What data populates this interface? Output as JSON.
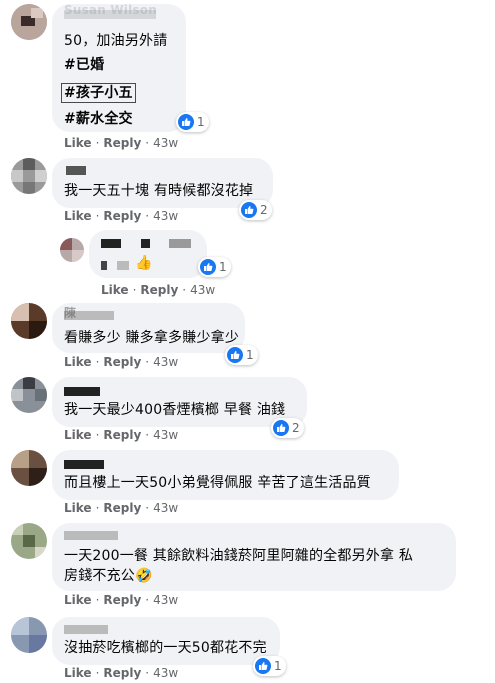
{
  "actions": {
    "like": "Like",
    "reply": "Reply",
    "sep": "·",
    "time": "43w"
  },
  "comments": [
    {
      "name": "Susan Wilson",
      "lines": [
        "50，加油另外請"
      ],
      "tags": [
        "#已婚",
        "#孩子小五",
        "#薪水全交"
      ],
      "reactions": "1"
    },
    {
      "name": "",
      "lines": [
        "我一天五十塊 有時候都沒花掉"
      ],
      "reactions": "2"
    },
    {
      "name": "",
      "lines": [
        "👍"
      ],
      "reactions": "1"
    },
    {
      "name": "陳",
      "lines": [
        "看賺多少 賺多拿多賺少拿少"
      ],
      "reactions": "1"
    },
    {
      "name": "",
      "lines": [
        "我一天最少400香煙檳榔 早餐 油錢"
      ],
      "reactions": "2"
    },
    {
      "name": "",
      "lines": [
        "而且樓上一天50小弟覺得佩服 辛苦了這生活品質"
      ]
    },
    {
      "name": "",
      "lines": [
        "一天200一餐 其餘飲料油錢菸阿里阿雜的全都另外拿 私",
        "房錢不充公🤣"
      ]
    },
    {
      "name": "",
      "lines": [
        "沒抽菸吃檳榔的一天50都花不完"
      ],
      "reactions": "1"
    }
  ],
  "colors": {
    "bubble": "#f0f2f5",
    "like_blue": "#1877f2",
    "meta_gray": "#65676b",
    "text": "#050505"
  },
  "icons": {
    "like": "thumbs-up-icon"
  }
}
